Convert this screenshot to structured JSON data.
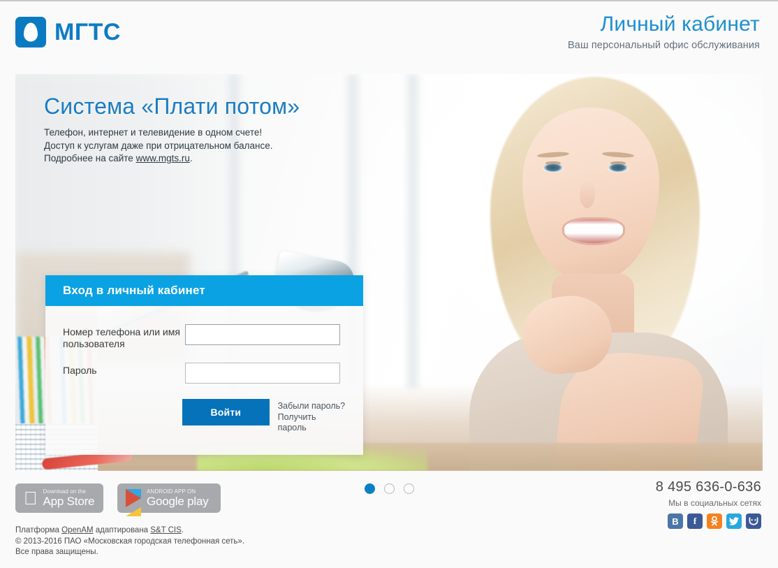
{
  "header": {
    "logo_text": "МГТС",
    "logo_icon": "mgts-drop-logo",
    "title": "Личный кабинет",
    "subtitle": "Ваш персональный офис обслуживания"
  },
  "hero": {
    "title": "Система «Плати потом»",
    "line1": "Телефон, интернет и телевидение в одном счете!",
    "line2": "Доступ к услугам даже при отрицательном балансе.",
    "line3_prefix": "Подробнее на сайте ",
    "link_text": "www.mgts.ru",
    "line3_suffix": "."
  },
  "login": {
    "header_title": "Вход в личный кабинет",
    "username_label": "Номер телефона или имя пользователя",
    "username_value": "",
    "username_placeholder": "",
    "password_label": "Пароль",
    "password_value": "",
    "password_placeholder": "",
    "submit_label": "Войти",
    "forgot_line1": "Забыли пароль?",
    "forgot_line2": "Получить пароль"
  },
  "carousel": {
    "slides": [
      {
        "active": true
      },
      {
        "active": false
      },
      {
        "active": false
      }
    ]
  },
  "footer": {
    "appstore": {
      "sub": "Download on the",
      "main": "App Store",
      "icon": "apple-icon"
    },
    "googleplay": {
      "sub": "ANDROID APP ON",
      "main": "Google play",
      "icon": "google-play-icon"
    },
    "legal_line1_prefix": "Платформа ",
    "legal_link1": "OpenAM",
    "legal_line1_mid": " адаптирована ",
    "legal_link2": "S&T CIS",
    "legal_line1_suffix": ".",
    "legal_line2": "© 2013-2016 ПАО «Московская городская телефонная сеть».",
    "legal_line3": "Все права защищены.",
    "phone": "8 495 636-0-636",
    "social_label": "Мы в социальных сетях",
    "socials": [
      {
        "name": "vk-icon",
        "glyph": "B",
        "color": "#4a76a8"
      },
      {
        "name": "facebook-icon",
        "glyph": "f",
        "color": "#3b5998"
      },
      {
        "name": "odnoklassniki-icon",
        "glyph": "ok",
        "color": "#f58220"
      },
      {
        "name": "twitter-icon",
        "glyph": "t",
        "color": "#29a8e0"
      },
      {
        "name": "moimir-icon",
        "glyph": "m",
        "color": "#3b5998"
      }
    ]
  },
  "colors": {
    "brand_blue": "#0d7cc3",
    "accent_cyan": "#0aa2e3",
    "button_blue": "#0572b9",
    "title_blue": "#1e8fd0",
    "page_bg": "#fafafa"
  }
}
